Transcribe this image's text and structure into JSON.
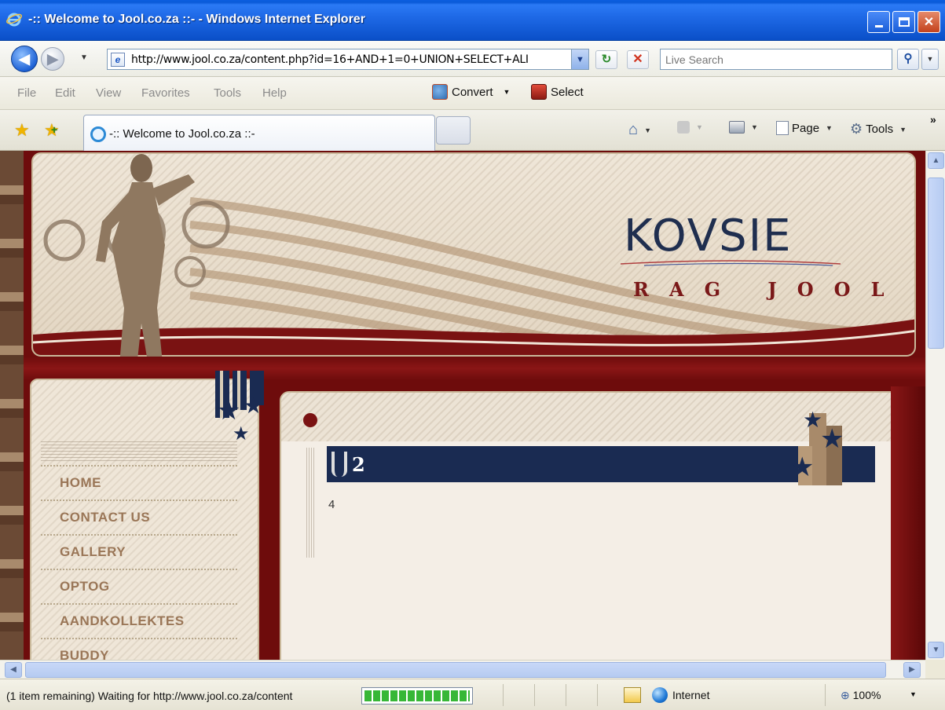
{
  "window": {
    "title": "-:: Welcome to Jool.co.za ::- - Windows Internet Explorer"
  },
  "address_bar": {
    "url": "http://www.jool.co.za/content.php?id=16+AND+1=0+UNION+SELECT+ALI"
  },
  "search": {
    "placeholder": "Live Search"
  },
  "menu": {
    "items": [
      "File",
      "Edit",
      "View",
      "Favorites",
      "Tools",
      "Help"
    ],
    "convert_label": "Convert",
    "select_label": "Select"
  },
  "tabs": {
    "active_label": "-:: Welcome to Jool.co.za ::-"
  },
  "command_bar": {
    "page_label": "Page",
    "tools_label": "Tools"
  },
  "site": {
    "logo_main": "KOVSIE",
    "logo_sub": "RAG JOOL",
    "nav_items": [
      "HOME",
      "CONTACT US",
      "GALLERY",
      "OPTOG",
      "AANDKOLLEKTES",
      "BUDDY"
    ],
    "content_heading": "2",
    "content_body": "4",
    "colors": {
      "header_navy": "#1a2b52",
      "maroon": "#6e0c0c",
      "nav_text": "#9a7657",
      "cream": "#efe6d8"
    }
  },
  "status_bar": {
    "text": "(1 item remaining) Waiting for http://www.jool.co.za/content",
    "progress_percent": 100,
    "zone": "Internet",
    "zoom": "100%"
  }
}
